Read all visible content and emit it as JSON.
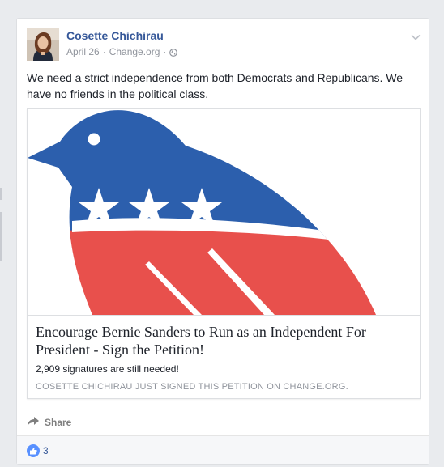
{
  "post": {
    "author": "Cosette Chichirau",
    "date": "April 26",
    "separator1": "·",
    "source": "Change.org",
    "separator2": "·",
    "text": "We need a strict independence from both Democrats and Republicans. We have no friends in the political class.",
    "privacy_icon": "globe-icon",
    "menu_icon": "chevron-down-icon"
  },
  "card": {
    "title": "Encourage Bernie Sanders to Run as an Independent For President - Sign the Petition!",
    "description": "2,909 signatures are still needed!",
    "caption": "COSETTE CHICHIRAU JUST SIGNED THIS PETITION ON CHANGE.ORG.",
    "image_icon": "bird-logo-icon"
  },
  "actions": {
    "share_label": "Share",
    "share_icon": "share-arrow-icon"
  },
  "reactions": {
    "count": "3",
    "icon": "like-icon"
  },
  "colors": {
    "link_blue": "#365899",
    "bird_blue": "#2c5fad",
    "bird_red": "#e8504c",
    "like_blue": "#5890ff"
  }
}
